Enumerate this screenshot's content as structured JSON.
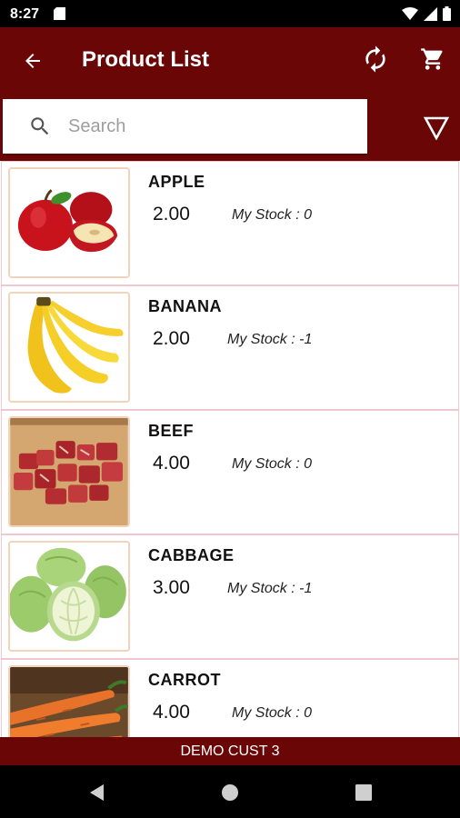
{
  "status_bar": {
    "time": "8:27",
    "icons": [
      "sd-card-icon",
      "wifi-icon",
      "signal-icon",
      "battery-icon"
    ]
  },
  "app_bar": {
    "title": "Product List",
    "back_icon": "arrow-left-icon",
    "refresh_icon": "refresh-icon",
    "cart_icon": "cart-icon"
  },
  "search": {
    "placeholder": "Search",
    "value": "",
    "icon": "search-icon",
    "filter_icon": "filter-icon"
  },
  "products": [
    {
      "name": "APPLE",
      "price": "2.00",
      "stock": "My Stock : 0",
      "image": "apple"
    },
    {
      "name": "BANANA",
      "price": "2.00",
      "stock": "My Stock : -1",
      "image": "banana"
    },
    {
      "name": "BEEF",
      "price": "4.00",
      "stock": "My Stock : 0",
      "image": "beef"
    },
    {
      "name": "CABBAGE",
      "price": "3.00",
      "stock": "My Stock : -1",
      "image": "cabbage"
    },
    {
      "name": "CARROT",
      "price": "4.00",
      "stock": "My Stock : 0",
      "image": "carrot"
    }
  ],
  "customer": {
    "name": "DEMO CUST 3"
  },
  "nav_bar": {
    "icons": [
      "back-triangle-icon",
      "home-circle-icon",
      "recents-square-icon"
    ]
  },
  "colors": {
    "primary": "#6b0606",
    "card_border": "#f1c8cf",
    "thumb_border": "#f2d3bc"
  }
}
